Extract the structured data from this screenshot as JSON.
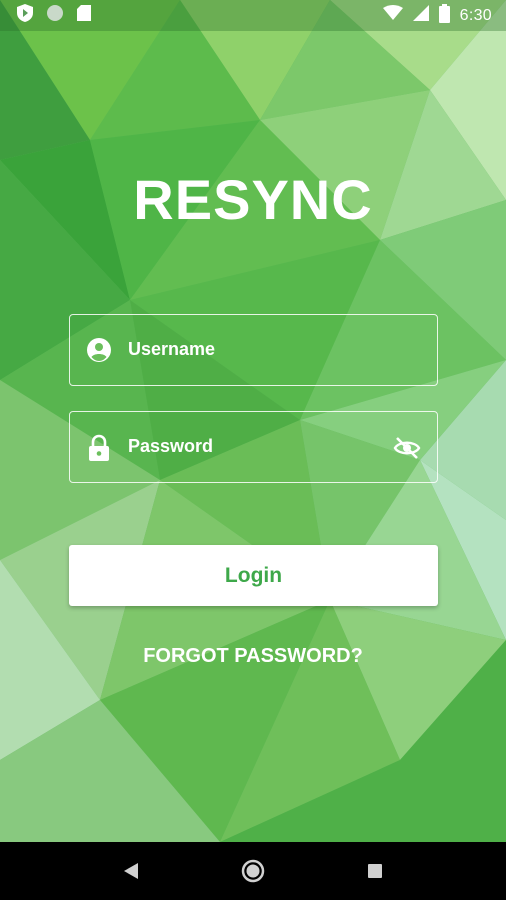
{
  "status_bar": {
    "time": "6:30",
    "icons": [
      "shield-icon",
      "circle-icon",
      "sd-card-icon",
      "wifi-icon",
      "signal-icon",
      "battery-icon"
    ]
  },
  "app": {
    "title": "RESYNC"
  },
  "username_field": {
    "placeholder": "Username",
    "icon": "account-circle-icon"
  },
  "password_field": {
    "placeholder": "Password",
    "icon": "lock-icon",
    "toggle_icon": "visibility-off-icon"
  },
  "login_button": {
    "label": "Login",
    "color": "#3ea84a"
  },
  "forgot_password": {
    "label": "FORGOT PASSWORD?"
  },
  "nav_bar": {
    "icons": [
      "back-icon",
      "home-icon",
      "recents-icon"
    ]
  },
  "colors": {
    "background_green": "#4cae4c",
    "accent_green": "#3ea84a"
  }
}
